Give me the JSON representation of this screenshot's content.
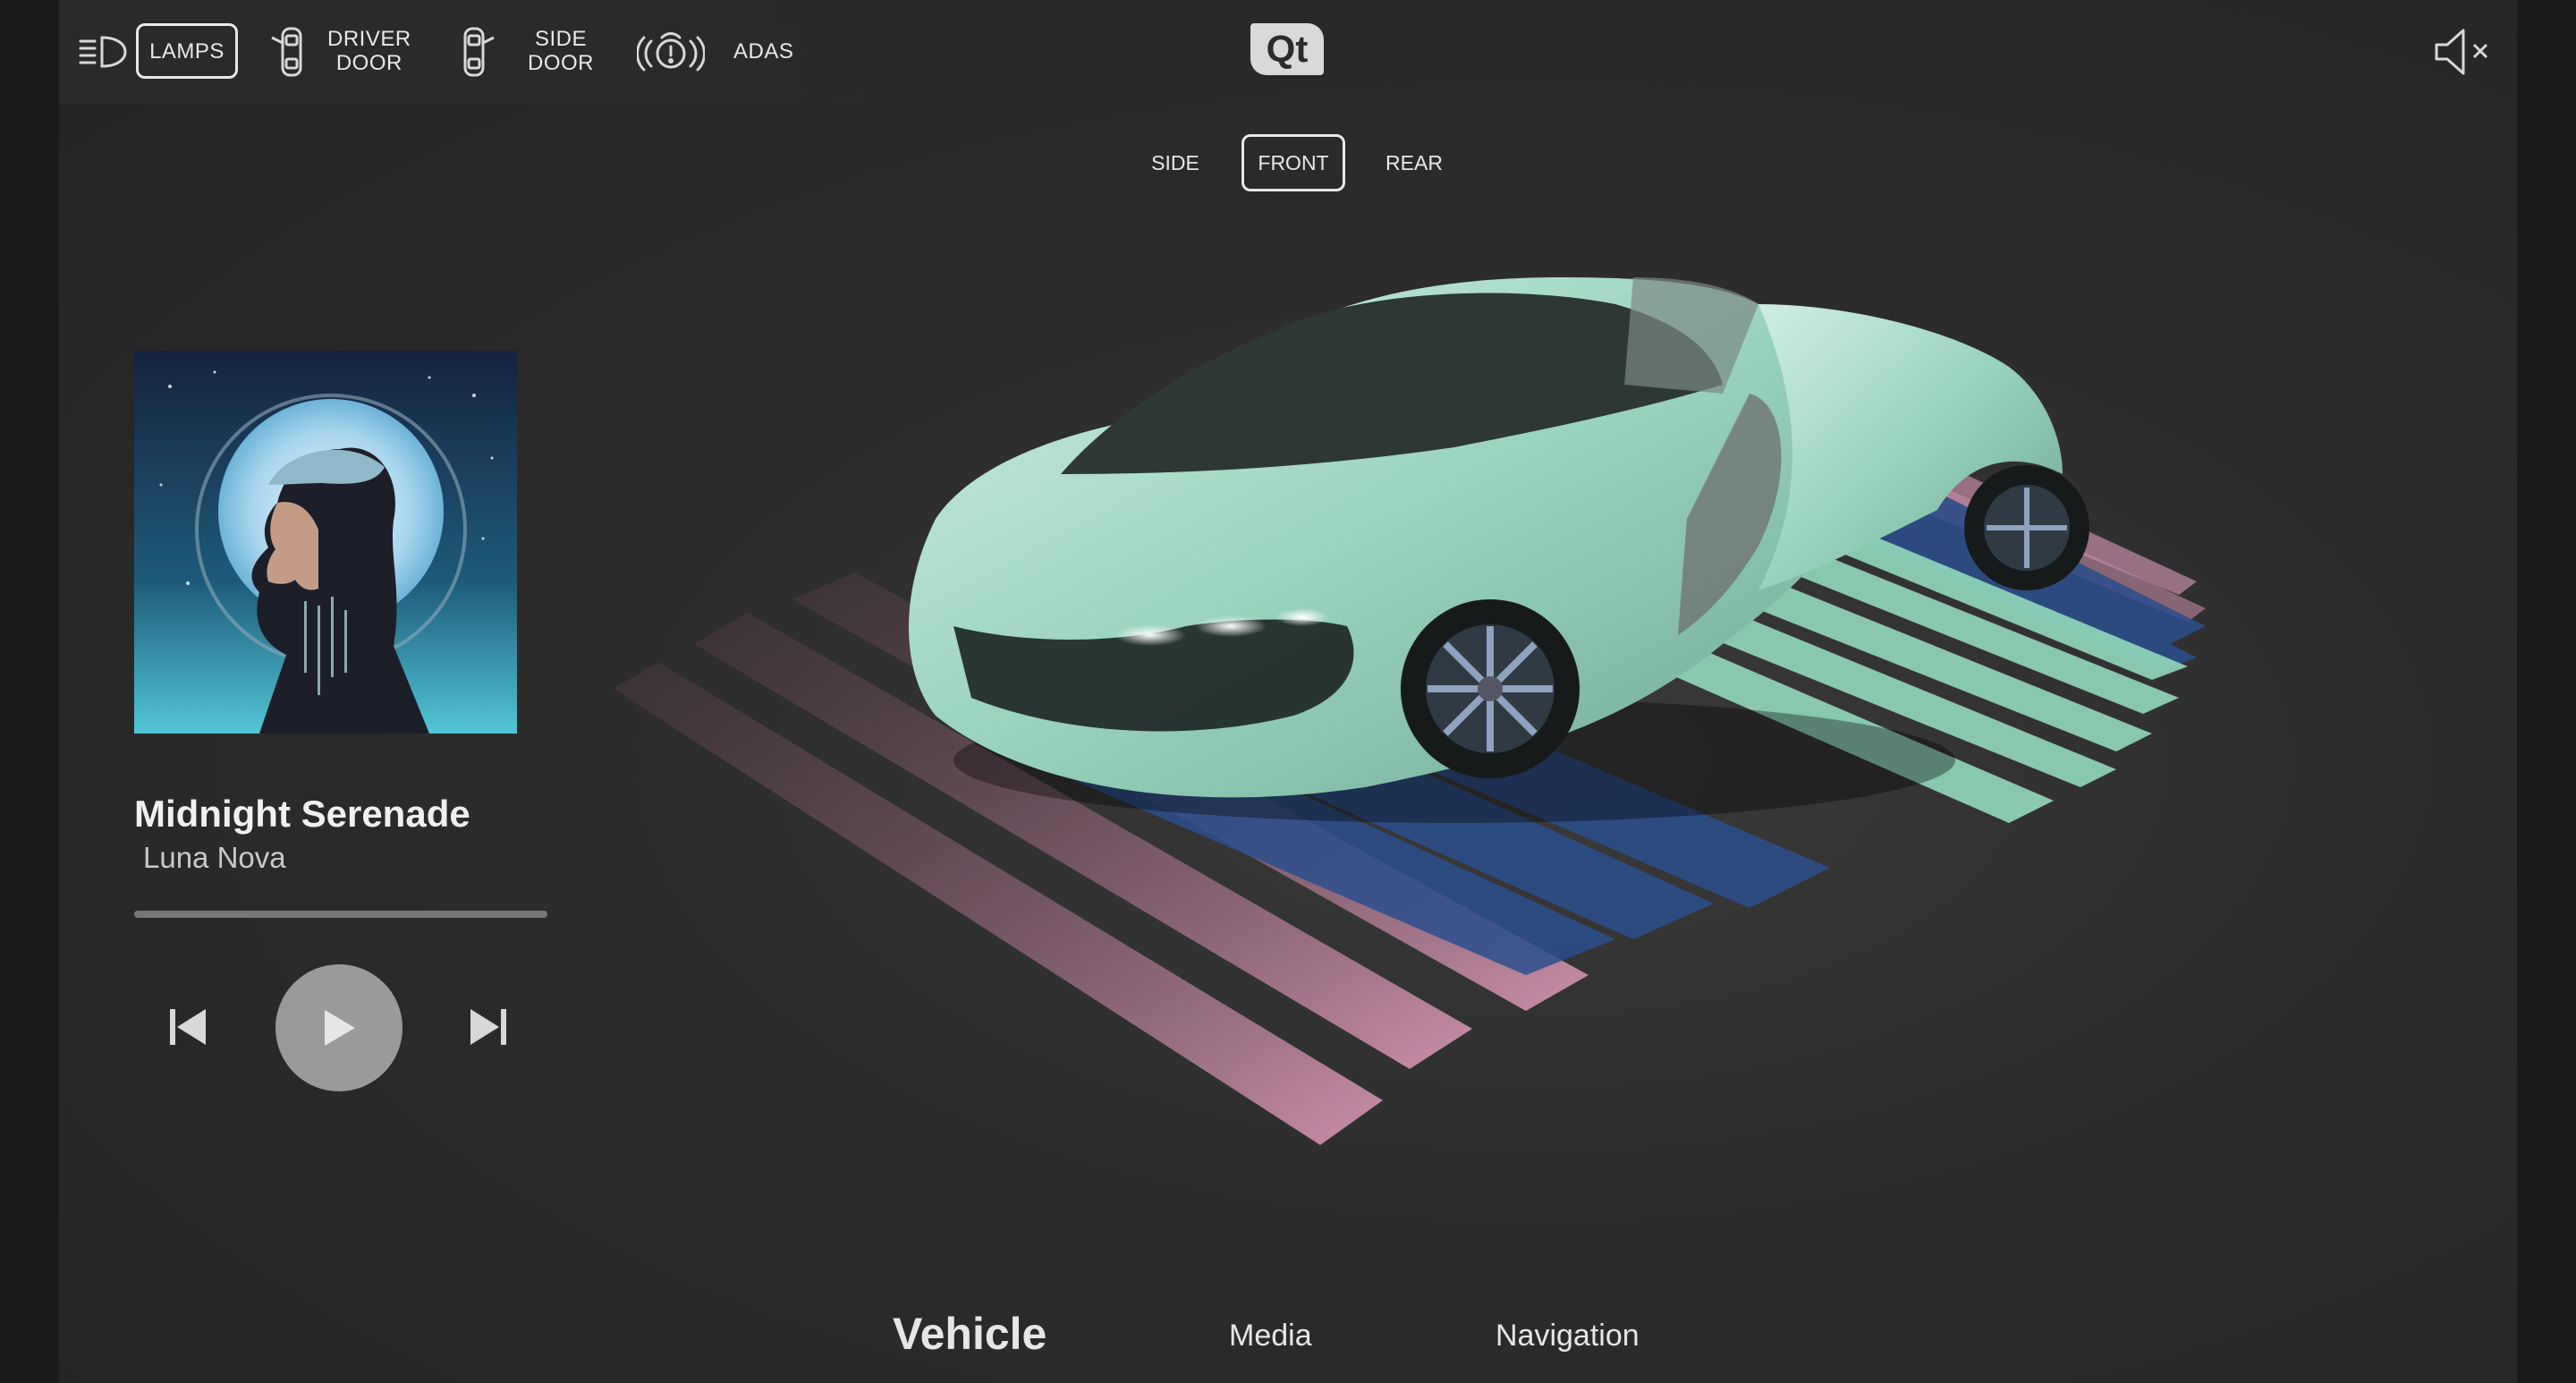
{
  "topbar": {
    "lamps_label": "LAMPS",
    "driver_door_line1": "DRIVER",
    "driver_door_line2": "DOOR",
    "side_door_line1": "SIDE",
    "side_door_line2": "DOOR",
    "adas_label": "ADAS",
    "logo_text": "Qt",
    "icons": [
      "headlamp-icon",
      "driver-door-icon",
      "side-door-icon",
      "adas-warning-icon",
      "mute-icon"
    ]
  },
  "view_tabs": [
    {
      "label": "SIDE",
      "active": false
    },
    {
      "label": "FRONT",
      "active": true
    },
    {
      "label": "REAR",
      "active": false
    }
  ],
  "media": {
    "song_title": "Midnight Serenade",
    "artist": "Luna Nova",
    "progress": 0.0,
    "icons": [
      "previous-track-icon",
      "play-icon",
      "next-track-icon"
    ]
  },
  "bottom_nav": [
    {
      "label": "Vehicle",
      "active": true
    },
    {
      "label": "Media",
      "active": false
    },
    {
      "label": "Navigation",
      "active": false
    }
  ],
  "colors": {
    "background": "#2c2c2c",
    "car_body": "#9fd3c0",
    "stripe_pink": "#c48aa6",
    "stripe_mint": "#93d8bd",
    "stripe_blue": "#2b4f8c"
  }
}
